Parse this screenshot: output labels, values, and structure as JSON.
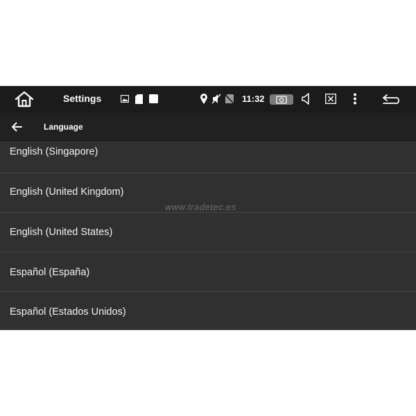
{
  "status_bar": {
    "title": "Settings",
    "time": "11:32",
    "icons": [
      "home-icon",
      "image-icon",
      "sd-card-icon",
      "notification-square-icon",
      "location-icon",
      "mute-icon",
      "no-sim-icon",
      "camera-icon",
      "volume-icon",
      "close-window-icon",
      "more-vert-icon",
      "return-icon"
    ]
  },
  "action_bar": {
    "title": "Language"
  },
  "languages": [
    "English (Singapore)",
    "English (United Kingdom)",
    "English (United States)",
    "Español (España)",
    "Español (Estados Unidos)"
  ],
  "watermark": "www.tradetec.es",
  "colors": {
    "background": "#303030",
    "status_bar": "#1b1b1b",
    "action_bar": "#212121",
    "divider": "#454545",
    "text": "#f2f2f2"
  }
}
